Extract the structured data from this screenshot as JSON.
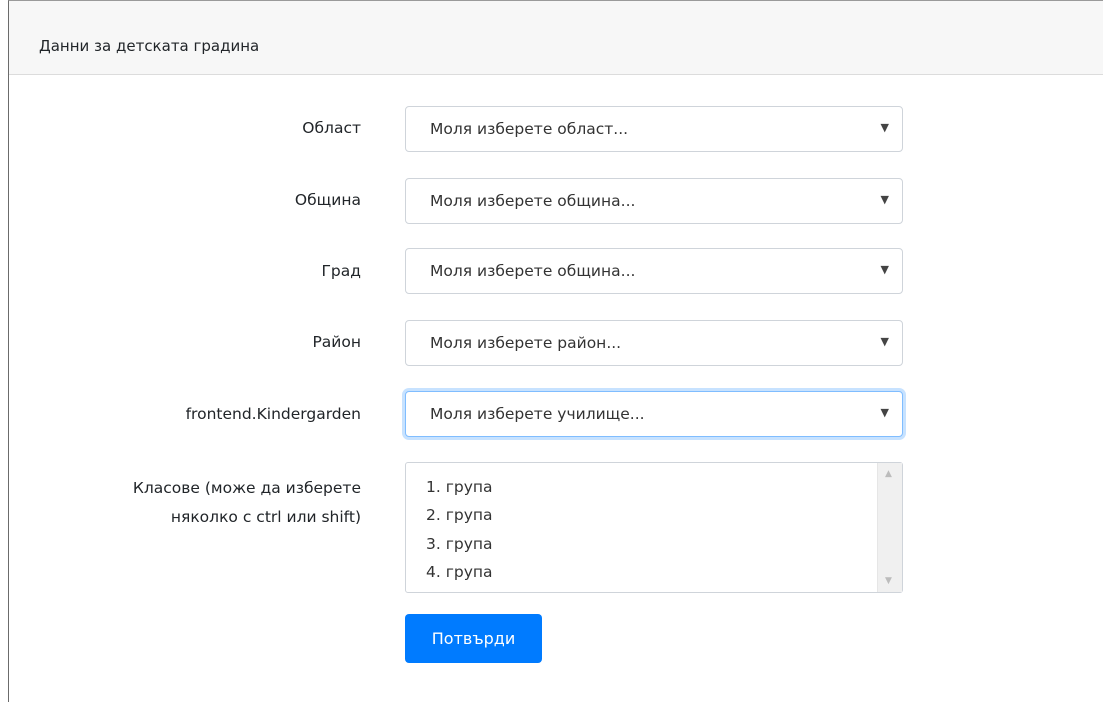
{
  "card": {
    "title": "Данни за детската градина"
  },
  "form": {
    "fields": [
      {
        "label": "Област",
        "value": "Моля изберете област..."
      },
      {
        "label": "Община",
        "value": "Моля изберете община..."
      },
      {
        "label": "Град",
        "value": "Моля изберете община..."
      },
      {
        "label": "Район",
        "value": "Моля изберете район..."
      },
      {
        "label": "frontend.Kindergarden",
        "value": "Моля изберете училище..."
      }
    ],
    "classes": {
      "label_line1": "Класове (може да изберете",
      "label_line2": "няколко с ctrl или shift)",
      "options": [
        "1. група",
        "2. група",
        "3. група",
        "4. група"
      ]
    },
    "submit_label": "Потвърди"
  },
  "colors": {
    "primary": "#007bff",
    "focus": "#80bdff"
  },
  "icons": {
    "select_caret": "caret-down-icon",
    "scroll_up": "scroll-up-icon",
    "scroll_down": "scroll-down-icon"
  }
}
